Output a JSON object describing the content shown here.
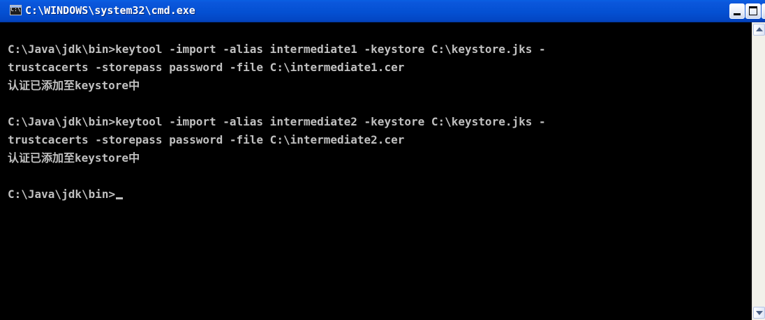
{
  "window": {
    "title": "C:\\WINDOWS\\system32\\cmd.exe",
    "icon": "console-icon",
    "icon_text": "C:\\",
    "titlebar_color": "#0450d2",
    "minimize_icon": "minimize-icon",
    "maximize_icon": "maximize-icon",
    "close_icon": "close-icon",
    "close_glyph": "×"
  },
  "console": {
    "background_color": "#000000",
    "text_color": "#c0c0c0",
    "lines": [
      "",
      "C:\\Java\\jdk\\bin>keytool -import -alias intermediate1 -keystore C:\\keystore.jks -",
      "trustcacerts -storepass password -file C:\\intermediate1.cer",
      "认证已添加至keystore中",
      "",
      "C:\\Java\\jdk\\bin>keytool -import -alias intermediate2 -keystore C:\\keystore.jks -",
      "trustcacerts -storepass password -file C:\\intermediate2.cer",
      "认证已添加至keystore中",
      "",
      "C:\\Java\\jdk\\bin>"
    ],
    "cursor": "underscore-cursor"
  },
  "scrollbar": {
    "up_icon": "scroll-up-arrow-icon",
    "down_icon": "scroll-down-arrow-icon"
  }
}
